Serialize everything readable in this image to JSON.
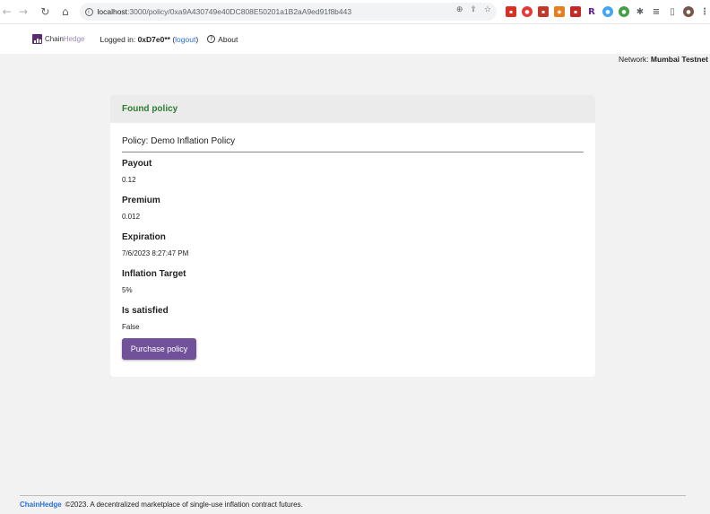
{
  "browser": {
    "url_host": "localhost",
    "url_path": ":3000/policy/0xa9A430749e40DC808E50201a1B2aA9ed91f8b443"
  },
  "nav": {
    "brand_chain": "Chain",
    "brand_hedge": "Hedge",
    "logged_in_prefix": "Logged in: ",
    "account": "0xD7e0**",
    "logout_label": "logout",
    "about_label": "About"
  },
  "network": {
    "label": "Network:",
    "name": "Mumbai Testnet"
  },
  "card": {
    "header": "Found policy",
    "policy_title": "Policy: Demo Inflation Policy",
    "fields": [
      {
        "label": "Payout",
        "value": "0.12"
      },
      {
        "label": "Premium",
        "value": "0.012"
      },
      {
        "label": "Expiration",
        "value": "7/6/2023 8:27:47 PM"
      },
      {
        "label": "Inflation Target",
        "value": "5%"
      },
      {
        "label": "Is satisfied",
        "value": "False"
      }
    ],
    "purchase_label": "Purchase policy"
  },
  "footer": {
    "brand": "ChainHedge",
    "text": "©2023. A decentralized marketplace of single-use inflation contract futures."
  },
  "colors": {
    "accent": "#71519a",
    "success": "#2e7d32",
    "link": "#2a6fd6"
  }
}
